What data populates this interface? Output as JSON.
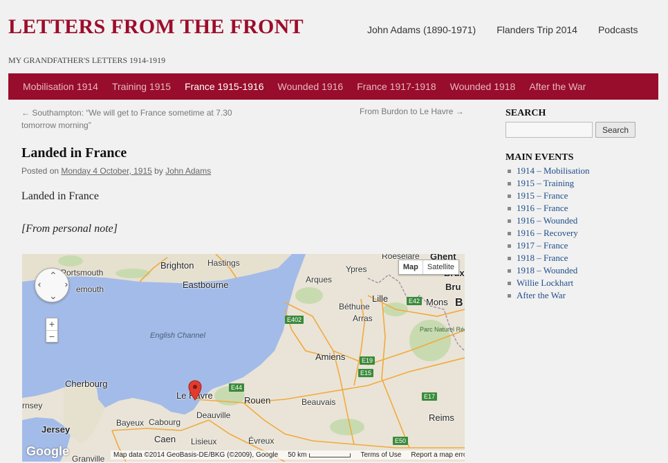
{
  "header": {
    "title": "LETTERS FROM THE FRONT",
    "description": "MY GRANDFATHER'S LETTERS 1914-1919",
    "top_links": [
      "John Adams (1890-1971)",
      "Flanders Trip 2014",
      "Podcasts"
    ]
  },
  "nav": {
    "items": [
      "Mobilisation 1914",
      "Training 1915",
      "France 1915-1916",
      "Wounded 1916",
      "France 1917-1918",
      "Wounded 1918",
      "After the War"
    ],
    "active_index": 2
  },
  "post_nav": {
    "prev": "← Southampton: “We will get to France sometime at 7.30 tomorrow morning”",
    "next": "From Burdon to Le Havre →"
  },
  "post": {
    "title": "Landed in France",
    "meta_prefix": "Posted on",
    "date": "Monday 4 October, 1915",
    "meta_by": "by",
    "author": "John Adams",
    "body": "Landed in France",
    "italic_note": "[From personal note]"
  },
  "map": {
    "type_buttons": [
      "Map",
      "Satellite"
    ],
    "zoom_in": "+",
    "zoom_out": "−",
    "logo": "Google",
    "attribution": "Map data ©2014 GeoBasis-DE/BKG (©2009), Google",
    "scale": "50 km",
    "terms": "Terms of Use",
    "report": "Report a map error",
    "places": {
      "portsmouth": "Portsmouth",
      "brighton": "Brighton",
      "hastings": "Hastings",
      "eastbourne": "Eastbourne",
      "emouth": "emouth",
      "channel": "English Channel",
      "cherbourg": "Cherbourg",
      "jersey": "Jersey",
      "rnsey": "rnsey",
      "le_havre": "Le Havre",
      "deauville": "Deauville",
      "bayeux": "Bayeux",
      "cabourg": "Cabourg",
      "caen": "Caen",
      "lisieux": "Lisieux",
      "evreux": "Évreux",
      "granville": "Granville",
      "rouen": "Rouen",
      "beauvais": "Beauvais",
      "amiens": "Amiens",
      "arras": "Arras",
      "bethune": "Béthune",
      "lille": "Lille",
      "arques": "Arques",
      "ypres": "Ypres",
      "mons": "Mons",
      "reims": "Reims",
      "ghent": "Ghent",
      "roeselare": "Roeselare",
      "brux": "Bruxe",
      "bru": "Bru",
      "b": "B",
      "parc": "Parc Naturel Régional de l'Avesnois"
    },
    "roads": [
      "E402",
      "E42",
      "E19",
      "E15",
      "E44",
      "E17",
      "E50"
    ]
  },
  "sidebar": {
    "search_heading": "SEARCH",
    "search_value": "",
    "search_button": "Search",
    "events_heading": "MAIN EVENTS",
    "events": [
      "1914 – Mobilisation",
      "1915 – Training",
      "1915 – France",
      "1916 – France",
      "1916 – Wounded",
      "1916 – Recovery",
      "1917 – France",
      "1918 – France",
      "1918 – Wounded",
      "Willie Lockhart",
      "After the War"
    ]
  },
  "colors": {
    "brand": "#9c0d2b",
    "nav_bg": "#980d2b",
    "link": "#1f4d8a",
    "sea": "#a3bbe8"
  }
}
